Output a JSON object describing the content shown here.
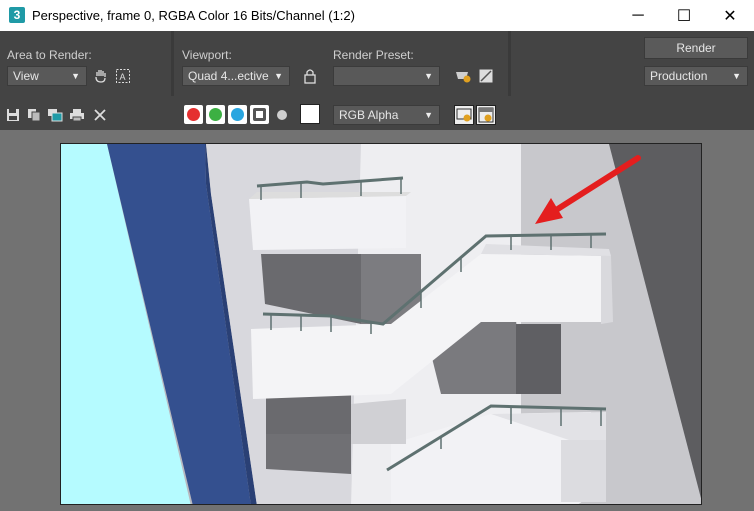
{
  "window": {
    "app_icon_label": "3",
    "title": "Perspective, frame 0, RGBA Color 16 Bits/Channel (1:2)",
    "minimize_glyph": "─",
    "maximize_glyph": "☐",
    "close_glyph": "✕"
  },
  "panel": {
    "area_label": "Area to Render:",
    "area_value": "View",
    "viewport_label": "Viewport:",
    "viewport_value": "Quad 4...ective",
    "preset_label": "Render Preset:",
    "preset_value": "",
    "render_button": "Render",
    "production_value": "Production",
    "dropdown_arrow": "▼"
  },
  "toolbar": {
    "channel_display_value": "RGB Alpha"
  },
  "colors": {
    "red_channel": "#e53030",
    "green_channel": "#3cb043",
    "blue_channel": "#2aa6e0",
    "sky": "#b5fbff",
    "annotation_arrow": "#e41e1e"
  }
}
